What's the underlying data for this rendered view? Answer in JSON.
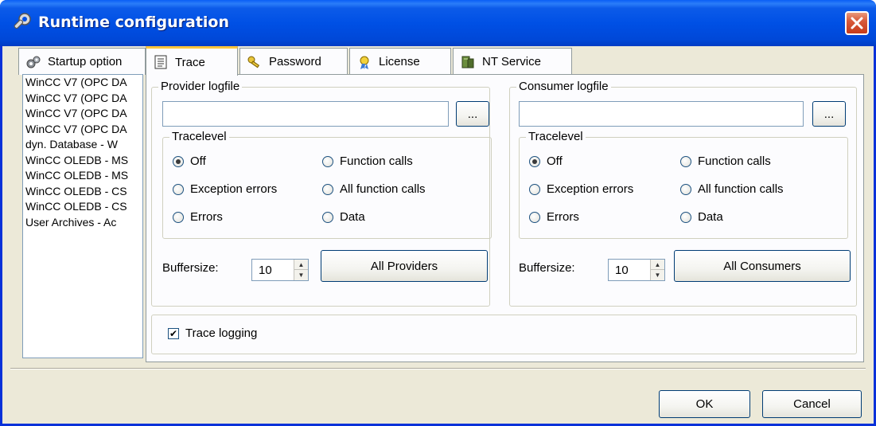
{
  "window": {
    "title": "Runtime configuration"
  },
  "tabs": [
    {
      "label": "Startup option",
      "icon": "gears-icon"
    },
    {
      "label": "Trace",
      "icon": "notepad-icon"
    },
    {
      "label": "Password",
      "icon": "keys-icon"
    },
    {
      "label": "License",
      "icon": "certificate-icon"
    },
    {
      "label": "NT Service",
      "icon": "server-icon"
    }
  ],
  "left_list": [
    "WinCC V7 (OPC DA",
    "WinCC V7 (OPC DA",
    "WinCC V7 (OPC DA",
    "WinCC V7 (OPC DA",
    "dyn. Database - W",
    "WinCC OLEDB - MS",
    "WinCC OLEDB - MS",
    "WinCC OLEDB - CS",
    "WinCC OLEDB - CS",
    "User Archives - Ac"
  ],
  "provider": {
    "group_title": "Provider logfile",
    "logfile_value": "",
    "browse_label": "...",
    "tracelevel_title": "Tracelevel",
    "options": [
      "Off",
      "Exception errors",
      "Errors",
      "Function calls",
      "All function calls",
      "Data"
    ],
    "selected": "Off",
    "buffersize_label": "Buffersize:",
    "buffersize_value": "10",
    "all_button": "All Providers"
  },
  "consumer": {
    "group_title": "Consumer logfile",
    "logfile_value": "",
    "browse_label": "...",
    "tracelevel_title": "Tracelevel",
    "options": [
      "Off",
      "Exception errors",
      "Errors",
      "Function calls",
      "All function calls",
      "Data"
    ],
    "selected": "Off",
    "buffersize_label": "Buffersize:",
    "buffersize_value": "10",
    "all_button": "All Consumers"
  },
  "trace_logging": {
    "label": "Trace logging",
    "checked": true
  },
  "footer": {
    "ok_label": "OK",
    "cancel_label": "Cancel"
  },
  "colors": {
    "titlebar": "#0050e5",
    "close": "#c63b1a",
    "dialog_bg": "#ece9d8",
    "tab_highlight": "#ffc73c"
  }
}
